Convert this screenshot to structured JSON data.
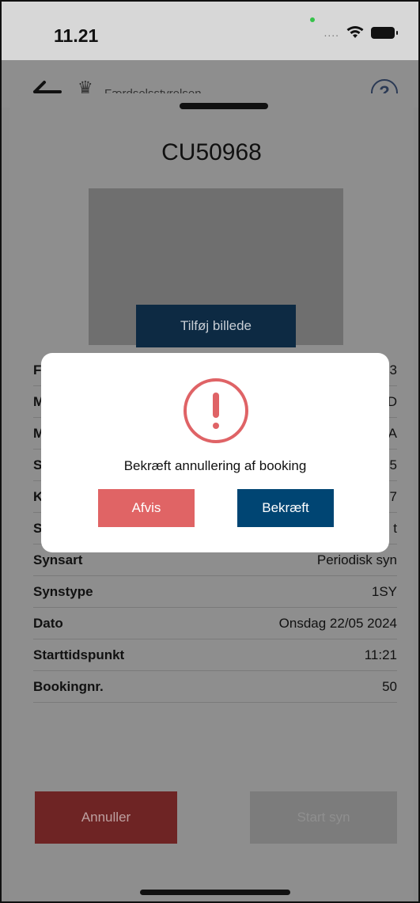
{
  "status_bar": {
    "time": "11.21",
    "signal_dots": "...."
  },
  "header": {
    "brand_text": "Færdselsstyrelsen",
    "help_label": "?"
  },
  "vehicle": {
    "plate": "CU50968",
    "add_photo_label": "Tilføj billede"
  },
  "hidden_rows": [
    {
      "label": "F",
      "value": "3"
    },
    {
      "label": "M",
      "value": "D"
    },
    {
      "label": "M",
      "value": "A"
    },
    {
      "label": "S",
      "value": "5"
    },
    {
      "label": "K",
      "value": "7"
    },
    {
      "label": "S",
      "value": "t"
    }
  ],
  "details": [
    {
      "label": "Synsart",
      "value": "Periodisk syn"
    },
    {
      "label": "Synstype",
      "value": "1SY"
    },
    {
      "label": "Dato",
      "value": "Onsdag 22/05 2024"
    },
    {
      "label": "Starttidspunkt",
      "value": "11:21"
    },
    {
      "label": "Bookingnr.",
      "value": "50"
    }
  ],
  "actions": {
    "cancel_label": "Annuller",
    "start_label": "Start syn"
  },
  "modal": {
    "message": "Bekræft annullering af booking",
    "reject_label": "Afvis",
    "confirm_label": "Bekræft"
  },
  "colors": {
    "accent_blue": "#004573",
    "danger_red": "#e06465",
    "warning_icon": "#df6366"
  }
}
